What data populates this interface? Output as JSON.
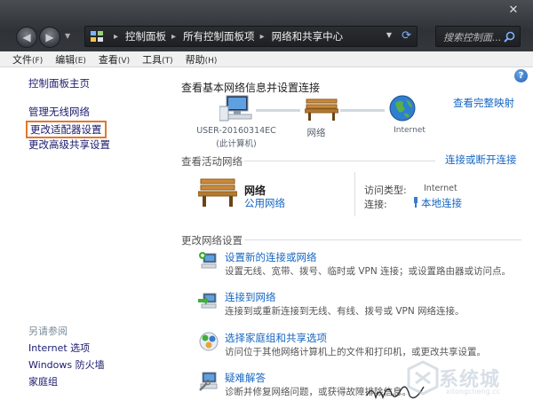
{
  "window": {
    "close_glyph": "✕",
    "back_glyph": "◀",
    "forward_glyph": "▶"
  },
  "address": {
    "crumbs": [
      "控制面板",
      "所有控制面板项",
      "网络和共享中心"
    ]
  },
  "search": {
    "placeholder": "搜索控制面..."
  },
  "menu": {
    "items": [
      {
        "label": "文件",
        "key": "(F)"
      },
      {
        "label": "编辑",
        "key": "(E)"
      },
      {
        "label": "查看",
        "key": "(V)"
      },
      {
        "label": "工具",
        "key": "(T)"
      },
      {
        "label": "帮助",
        "key": "(H)"
      }
    ]
  },
  "sidebar": {
    "home": "控制面板主页",
    "wireless": "管理无线网络",
    "adapter": "更改适配器设置",
    "sharing": "更改高级共享设置",
    "see_also": "另请参阅",
    "internet_options": "Internet 选项",
    "firewall": "Windows 防火墙",
    "homegroup": "家庭组"
  },
  "main": {
    "heading": "查看基本网络信息并设置连接",
    "full_map": "查看完整映射",
    "computer_name": "USER-20160314EC",
    "computer_sub": "(此计算机)",
    "network_label": "网络",
    "internet_label": "Internet",
    "active_title": "查看活动网络",
    "connect_link": "连接或断开连接",
    "net_name": "网络",
    "net_type": "公用网络",
    "access_label": "访问类型:",
    "access_value": "Internet",
    "conn_label": "连接:",
    "conn_value": "本地连接",
    "change_title": "更改网络设置",
    "tasks": [
      {
        "title": "设置新的连接或网络",
        "desc": "设置无线、宽带、拨号、临时或 VPN 连接；或设置路由器或访问点。"
      },
      {
        "title": "连接到网络",
        "desc": "连接到或重新连接到无线、有线、拨号或 VPN 网络连接。"
      },
      {
        "title": "选择家庭组和共享选项",
        "desc": "访问位于其他网络计算机上的文件和打印机，或更改共享设置。"
      },
      {
        "title": "疑难解答",
        "desc": "诊断并修复网络问题，或获得故障排除信息。"
      }
    ]
  },
  "watermark": {
    "text": "系统城",
    "url": "xitongcheng.cc"
  },
  "colors": {
    "link": "#1566c2",
    "highlight_box": "#e3782b",
    "chrome": "#2f3236"
  },
  "icons": [
    "close-icon",
    "back-icon",
    "forward-icon",
    "control-panel-icon",
    "refresh-icon",
    "search-icon",
    "help-icon",
    "computer-icon",
    "network-bench-icon",
    "internet-globe-icon",
    "connection-icon",
    "new-connection-icon",
    "connect-network-icon",
    "homegroup-icon",
    "troubleshoot-icon"
  ]
}
